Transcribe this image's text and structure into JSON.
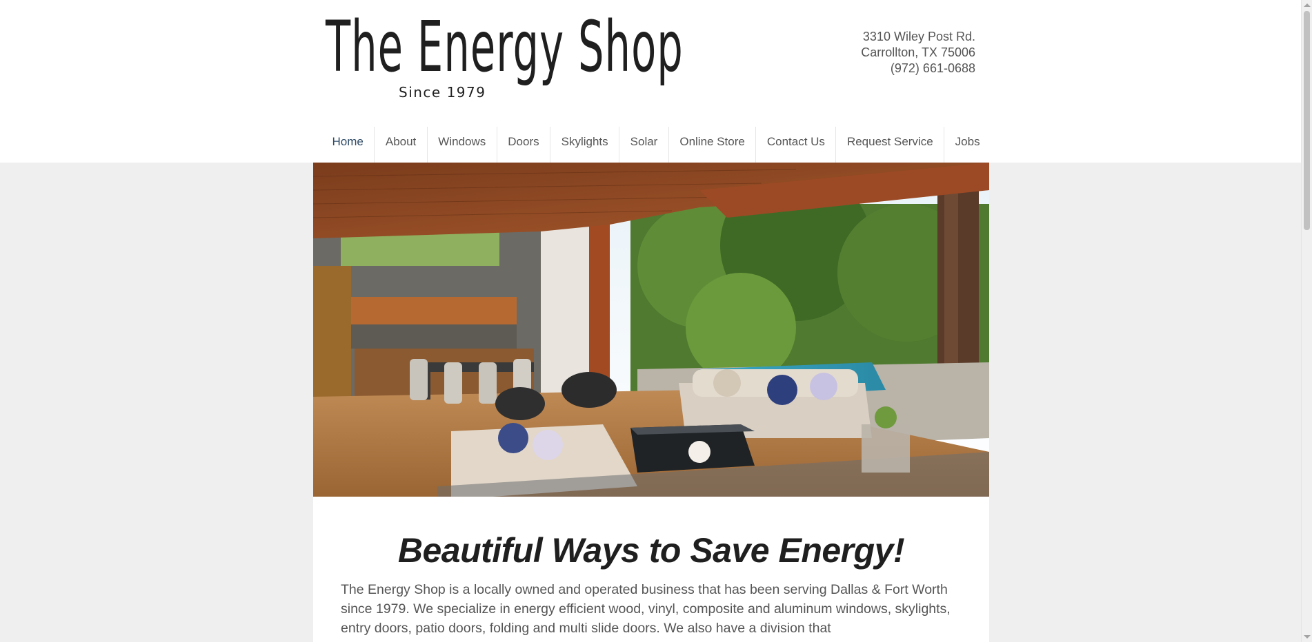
{
  "header": {
    "logo_title": "The Energy Shop",
    "logo_subtitle": "Since 1979",
    "address_line1": "3310 Wiley Post Rd.",
    "address_line2": "Carrollton, TX 75006",
    "phone": "(972) 661-0688"
  },
  "nav": {
    "items": [
      {
        "label": "Home",
        "active": true
      },
      {
        "label": "About"
      },
      {
        "label": "Windows"
      },
      {
        "label": "Doors"
      },
      {
        "label": "Skylights"
      },
      {
        "label": "Solar"
      },
      {
        "label": "Online Store"
      },
      {
        "label": "Contact Us"
      },
      {
        "label": "Request Service"
      },
      {
        "label": "Jobs"
      }
    ]
  },
  "main": {
    "headline": "Beautiful Ways to Save Energy!",
    "body": "The Energy Shop is a locally owned and operated business that has been serving Dallas & Fort Worth since 1979. We specialize in energy efficient wood, vinyl, composite and aluminum windows, skylights, entry doors, patio doors, folding and multi slide doors. We also have a division that"
  },
  "colors": {
    "nav_active": "#2d4a66",
    "nav_text": "#555555",
    "page_bg": "#efefef",
    "panel_bg": "#ffffff"
  }
}
